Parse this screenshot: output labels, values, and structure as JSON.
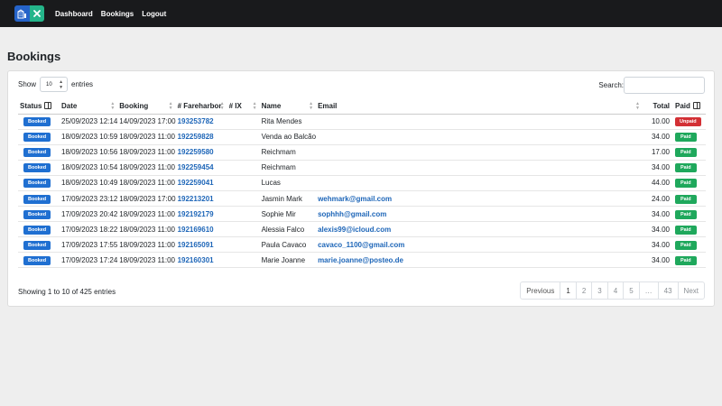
{
  "nav": {
    "items": [
      "Dashboard",
      "Bookings",
      "Logout"
    ]
  },
  "page": {
    "title": "Bookings"
  },
  "controls": {
    "show_label": "Show",
    "entries_label": "entries",
    "page_size": "10",
    "search_label": "Search:",
    "search_value": ""
  },
  "table": {
    "headers": {
      "status": "Status",
      "date": "Date",
      "booking": "Booking",
      "fareharbor": "# Fareharbor",
      "ix": "# IX",
      "name": "Name",
      "email": "Email",
      "total": "Total",
      "paid": "Paid"
    },
    "rows": [
      {
        "status": "Booked",
        "date": "25/09/2023 12:14",
        "booking": "14/09/2023 17:00",
        "fareharbor": "193253782",
        "ix": "",
        "name": "Rita Mendes",
        "email": "",
        "total": "10.00",
        "paid": "Unpaid"
      },
      {
        "status": "Booked",
        "date": "18/09/2023 10:59",
        "booking": "18/09/2023 11:00",
        "fareharbor": "192259828",
        "ix": "",
        "name": "Venda ao Balcão",
        "email": "",
        "total": "34.00",
        "paid": "Paid"
      },
      {
        "status": "Booked",
        "date": "18/09/2023 10:56",
        "booking": "18/09/2023 11:00",
        "fareharbor": "192259580",
        "ix": "",
        "name": "Reichmam",
        "email": "",
        "total": "17.00",
        "paid": "Paid"
      },
      {
        "status": "Booked",
        "date": "18/09/2023 10:54",
        "booking": "18/09/2023 11:00",
        "fareharbor": "192259454",
        "ix": "",
        "name": "Reichmam",
        "email": "",
        "total": "34.00",
        "paid": "Paid"
      },
      {
        "status": "Booked",
        "date": "18/09/2023 10:49",
        "booking": "18/09/2023 11:00",
        "fareharbor": "192259041",
        "ix": "",
        "name": "Lucas",
        "email": "",
        "total": "44.00",
        "paid": "Paid"
      },
      {
        "status": "Booked",
        "date": "17/09/2023 23:12",
        "booking": "18/09/2023 17:00",
        "fareharbor": "192213201",
        "ix": "",
        "name": "Jasmin Mark",
        "email": "wehmark@gmail.com",
        "total": "24.00",
        "paid": "Paid"
      },
      {
        "status": "Booked",
        "date": "17/09/2023 20:42",
        "booking": "18/09/2023 11:00",
        "fareharbor": "192192179",
        "ix": "",
        "name": "Sophie Mir",
        "email": "sophhh@gmail.com",
        "total": "34.00",
        "paid": "Paid"
      },
      {
        "status": "Booked",
        "date": "17/09/2023 18:22",
        "booking": "18/09/2023 11:00",
        "fareharbor": "192169610",
        "ix": "",
        "name": "Alessia Falco",
        "email": "alexis99@icloud.com",
        "total": "34.00",
        "paid": "Paid"
      },
      {
        "status": "Booked",
        "date": "17/09/2023 17:55",
        "booking": "18/09/2023 11:00",
        "fareharbor": "192165091",
        "ix": "",
        "name": "Paula Cavaco",
        "email": "cavaco_1100@gmail.com",
        "total": "34.00",
        "paid": "Paid"
      },
      {
        "status": "Booked",
        "date": "17/09/2023 17:24",
        "booking": "18/09/2023 11:00",
        "fareharbor": "192160301",
        "ix": "",
        "name": "Marie Joanne",
        "email": "marie.joanne@posteo.de",
        "total": "34.00",
        "paid": "Paid"
      }
    ]
  },
  "footer": {
    "info": "Showing 1 to 10 of 425 entries",
    "pages": [
      "Previous",
      "1",
      "2",
      "3",
      "4",
      "5",
      "…",
      "43",
      "Next"
    ]
  },
  "icons": {
    "logo": "building-icon",
    "logo_secondary": "x-mark-icon",
    "column_toggle": "columns-icon",
    "sort": "sort-arrows-icon"
  },
  "colors": {
    "navbar": "#191a1c",
    "booked": "#1f6fd1",
    "paid": "#1fa85c",
    "unpaid": "#d33035",
    "link": "#1e66b8"
  }
}
